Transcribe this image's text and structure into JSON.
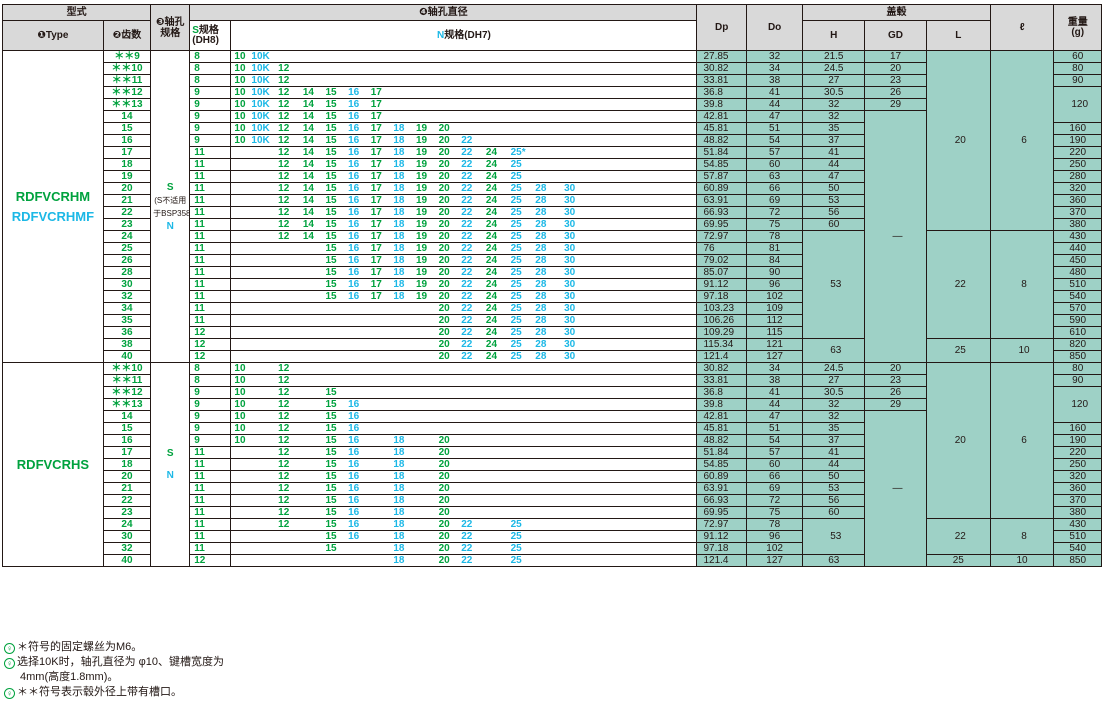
{
  "header": {
    "model": "型式",
    "type_num": "❶",
    "type": "Type",
    "teeth_num": "❷",
    "teeth": "齿数",
    "hole_num": "❸",
    "hole": "轴孔",
    "hole2": "规格",
    "dia_num": "❹",
    "dia": "轴孔直径",
    "s_spec_a": "S",
    "s_spec_b": "规格",
    "s_spec_c": "(DH8)",
    "n_spec_a": "N",
    "n_spec_b": "规格",
    "n_spec_c": "(DH7)",
    "dp": "Dp",
    "do": "Do",
    "hub": "盖毂",
    "h": "H",
    "gd": "GD",
    "l": "L",
    "ell": "ℓ",
    "weight": "重量",
    "weight_unit": "(g)"
  },
  "group1": {
    "type1": "RDFVCRHM",
    "type2": "RDFVCRHMF",
    "s": "S",
    "note": "(S不适用",
    "note2": "于BSP358)",
    "n": "N",
    "gd_dash": "—",
    "rows": [
      {
        "t": "**9",
        "s": "8",
        "n": [
          "10",
          "10K",
          "",
          "",
          "",
          "",
          "",
          "",
          "",
          "",
          "",
          "",
          "",
          "",
          "",
          ""
        ],
        "dp": "27.85",
        "do": "32",
        "h": "21.5",
        "gd": "17",
        "w": "60"
      },
      {
        "t": "**10",
        "s": "8",
        "n": [
          "10",
          "10K",
          "12",
          "",
          "",
          "",
          "",
          "",
          "",
          "",
          "",
          "",
          "",
          "",
          "",
          ""
        ],
        "dp": "30.82",
        "do": "34",
        "h": "24.5",
        "gd": "20",
        "w": "80"
      },
      {
        "t": "**11",
        "s": "8",
        "n": [
          "10",
          "10K",
          "12",
          "",
          "",
          "",
          "",
          "",
          "",
          "",
          "",
          "",
          "",
          "",
          "",
          ""
        ],
        "dp": "33.81",
        "do": "38",
        "h": "27",
        "gd": "23",
        "w": "90"
      },
      {
        "t": "**12",
        "s": "9",
        "n": [
          "10",
          "10K",
          "12",
          "14",
          "15",
          "16",
          "17",
          "",
          "",
          "",
          "",
          "",
          "",
          "",
          "",
          ""
        ],
        "dp": "36.8",
        "do": "41",
        "h": "30.5",
        "gd": "26",
        "w": ""
      },
      {
        "t": "**13",
        "s": "9",
        "n": [
          "10",
          "10K",
          "12",
          "14",
          "15",
          "16",
          "17",
          "",
          "",
          "",
          "",
          "",
          "",
          "",
          "",
          ""
        ],
        "dp": "39.8",
        "do": "44",
        "h": "32",
        "gd": "29",
        "w": ""
      },
      {
        "t": "14",
        "s": "9",
        "n": [
          "10",
          "10K",
          "12",
          "14",
          "15",
          "16",
          "17",
          "",
          "",
          "",
          "",
          "",
          "",
          "",
          "",
          ""
        ],
        "dp": "42.81",
        "do": "47",
        "h": "32",
        "gd": "",
        "w": ""
      },
      {
        "t": "15",
        "s": "9",
        "n": [
          "10",
          "10K",
          "12",
          "14",
          "15",
          "16",
          "17",
          "18",
          "19",
          "20",
          "",
          "",
          "",
          "",
          "",
          ""
        ],
        "dp": "45.81",
        "do": "51",
        "h": "35",
        "gd": "",
        "w": "160"
      },
      {
        "t": "16",
        "s": "9",
        "n": [
          "10",
          "10K",
          "12",
          "14",
          "15",
          "16",
          "17",
          "18",
          "19",
          "20",
          "22",
          "",
          "",
          "",
          "",
          ""
        ],
        "dp": "48.82",
        "do": "54",
        "h": "37",
        "gd": "",
        "w": "190"
      },
      {
        "t": "17",
        "s": "11",
        "n": [
          "",
          "",
          "12",
          "14",
          "15",
          "16",
          "17",
          "18",
          "19",
          "20",
          "22",
          "24",
          "25*",
          "",
          "",
          ""
        ],
        "dp": "51.84",
        "do": "57",
        "h": "41",
        "gd": "",
        "w": "220"
      },
      {
        "t": "18",
        "s": "11",
        "n": [
          "",
          "",
          "12",
          "14",
          "15",
          "16",
          "17",
          "18",
          "19",
          "20",
          "22",
          "24",
          "25",
          "",
          "",
          ""
        ],
        "dp": "54.85",
        "do": "60",
        "h": "44",
        "gd": "",
        "w": "250"
      },
      {
        "t": "19",
        "s": "11",
        "n": [
          "",
          "",
          "12",
          "14",
          "15",
          "16",
          "17",
          "18",
          "19",
          "20",
          "22",
          "24",
          "25",
          "",
          "",
          ""
        ],
        "dp": "57.87",
        "do": "63",
        "h": "47",
        "gd": "",
        "w": "280"
      },
      {
        "t": "20",
        "s": "11",
        "n": [
          "",
          "",
          "12",
          "14",
          "15",
          "16",
          "17",
          "18",
          "19",
          "20",
          "22",
          "24",
          "25",
          "28",
          "30",
          ""
        ],
        "dp": "60.89",
        "do": "66",
        "h": "50",
        "gd": "",
        "w": "320"
      },
      {
        "t": "21",
        "s": "11",
        "n": [
          "",
          "",
          "12",
          "14",
          "15",
          "16",
          "17",
          "18",
          "19",
          "20",
          "22",
          "24",
          "25",
          "28",
          "30",
          ""
        ],
        "dp": "63.91",
        "do": "69",
        "h": "53",
        "gd": "",
        "w": "360"
      },
      {
        "t": "22",
        "s": "11",
        "n": [
          "",
          "",
          "12",
          "14",
          "15",
          "16",
          "17",
          "18",
          "19",
          "20",
          "22",
          "24",
          "25",
          "28",
          "30",
          ""
        ],
        "dp": "66.93",
        "do": "72",
        "h": "56",
        "gd": "",
        "w": "370"
      },
      {
        "t": "23",
        "s": "11",
        "n": [
          "",
          "",
          "12",
          "14",
          "15",
          "16",
          "17",
          "18",
          "19",
          "20",
          "22",
          "24",
          "25",
          "28",
          "30",
          ""
        ],
        "dp": "69.95",
        "do": "75",
        "h": "60",
        "gd": "",
        "w": "380"
      },
      {
        "t": "24",
        "s": "11",
        "n": [
          "",
          "",
          "12",
          "14",
          "15",
          "16",
          "17",
          "18",
          "19",
          "20",
          "22",
          "24",
          "25",
          "28",
          "30",
          ""
        ],
        "dp": "72.97",
        "do": "78",
        "h": "",
        "gd": "",
        "w": "430"
      },
      {
        "t": "25",
        "s": "11",
        "n": [
          "",
          "",
          "",
          "",
          "15",
          "16",
          "17",
          "18",
          "19",
          "20",
          "22",
          "24",
          "25",
          "28",
          "30",
          ""
        ],
        "dp": "76",
        "do": "81",
        "h": "",
        "gd": "",
        "w": "440"
      },
      {
        "t": "26",
        "s": "11",
        "n": [
          "",
          "",
          "",
          "",
          "15",
          "16",
          "17",
          "18",
          "19",
          "20",
          "22",
          "24",
          "25",
          "28",
          "30",
          ""
        ],
        "dp": "79.02",
        "do": "84",
        "h": "",
        "gd": "",
        "w": "450"
      },
      {
        "t": "28",
        "s": "11",
        "n": [
          "",
          "",
          "",
          "",
          "15",
          "16",
          "17",
          "18",
          "19",
          "20",
          "22",
          "24",
          "25",
          "28",
          "30",
          ""
        ],
        "dp": "85.07",
        "do": "90",
        "h": "",
        "gd": "",
        "w": "480"
      },
      {
        "t": "30",
        "s": "11",
        "n": [
          "",
          "",
          "",
          "",
          "15",
          "16",
          "17",
          "18",
          "19",
          "20",
          "22",
          "24",
          "25",
          "28",
          "30",
          ""
        ],
        "dp": "91.12",
        "do": "96",
        "h": "",
        "gd": "",
        "w": "510"
      },
      {
        "t": "32",
        "s": "11",
        "n": [
          "",
          "",
          "",
          "",
          "15",
          "16",
          "17",
          "18",
          "19",
          "20",
          "22",
          "24",
          "25",
          "28",
          "30",
          ""
        ],
        "dp": "97.18",
        "do": "102",
        "h": "",
        "gd": "",
        "w": "540"
      },
      {
        "t": "34",
        "s": "11",
        "n": [
          "",
          "",
          "",
          "",
          "",
          "",
          "",
          "",
          "",
          "20",
          "22",
          "24",
          "25",
          "28",
          "30",
          ""
        ],
        "dp": "103.23",
        "do": "109",
        "h": "",
        "gd": "",
        "w": "570"
      },
      {
        "t": "35",
        "s": "11",
        "n": [
          "",
          "",
          "",
          "",
          "",
          "",
          "",
          "",
          "",
          "20",
          "22",
          "24",
          "25",
          "28",
          "30",
          ""
        ],
        "dp": "106.26",
        "do": "112",
        "h": "",
        "gd": "",
        "w": "590"
      },
      {
        "t": "36",
        "s": "12",
        "n": [
          "",
          "",
          "",
          "",
          "",
          "",
          "",
          "",
          "",
          "20",
          "22",
          "24",
          "25",
          "28",
          "30",
          ""
        ],
        "dp": "109.29",
        "do": "115",
        "h": "",
        "gd": "",
        "w": "610"
      },
      {
        "t": "38",
        "s": "12",
        "n": [
          "",
          "",
          "",
          "",
          "",
          "",
          "",
          "",
          "",
          "20",
          "22",
          "24",
          "25",
          "28",
          "30",
          ""
        ],
        "dp": "115.34",
        "do": "121",
        "h": "",
        "gd": "",
        "w": "820"
      },
      {
        "t": "40",
        "s": "12",
        "n": [
          "",
          "",
          "",
          "",
          "",
          "",
          "",
          "",
          "",
          "20",
          "22",
          "24",
          "25",
          "28",
          "30",
          ""
        ],
        "dp": "121.4",
        "do": "127",
        "h": "",
        "gd": "",
        "w": "850"
      }
    ],
    "merged": {
      "w120": "120",
      "h53": "53",
      "h63": "63",
      "l20": "20",
      "l22": "22",
      "l25": "25",
      "e6": "6",
      "e8": "8",
      "e10": "10"
    }
  },
  "group2": {
    "type": "RDFVCRHS",
    "s": "S",
    "n": "N",
    "gd_dash": "—",
    "rows": [
      {
        "t": "**10",
        "s": "8",
        "n": [
          "10",
          "",
          "12",
          "",
          "",
          "",
          "",
          "",
          "",
          "",
          "",
          "",
          "",
          "",
          "",
          ""
        ],
        "dp": "30.82",
        "do": "34",
        "h": "24.5",
        "gd": "20",
        "w": "80"
      },
      {
        "t": "**11",
        "s": "8",
        "n": [
          "10",
          "",
          "12",
          "",
          "",
          "",
          "",
          "",
          "",
          "",
          "",
          "",
          "",
          "",
          "",
          ""
        ],
        "dp": "33.81",
        "do": "38",
        "h": "27",
        "gd": "23",
        "w": "90"
      },
      {
        "t": "**12",
        "s": "9",
        "n": [
          "10",
          "",
          "12",
          "",
          "15",
          "",
          "",
          "",
          "",
          "",
          "",
          "",
          "",
          "",
          "",
          ""
        ],
        "dp": "36.8",
        "do": "41",
        "h": "30.5",
        "gd": "26",
        "w": ""
      },
      {
        "t": "**13",
        "s": "9",
        "n": [
          "10",
          "",
          "12",
          "",
          "15",
          "16",
          "",
          "",
          "",
          "",
          "",
          "",
          "",
          "",
          "",
          ""
        ],
        "dp": "39.8",
        "do": "44",
        "h": "32",
        "gd": "29",
        "w": ""
      },
      {
        "t": "14",
        "s": "9",
        "n": [
          "10",
          "",
          "12",
          "",
          "15",
          "16",
          "",
          "",
          "",
          "",
          "",
          "",
          "",
          "",
          "",
          ""
        ],
        "dp": "42.81",
        "do": "47",
        "h": "32",
        "gd": "",
        "w": ""
      },
      {
        "t": "15",
        "s": "9",
        "n": [
          "10",
          "",
          "12",
          "",
          "15",
          "16",
          "",
          "",
          "",
          "",
          "",
          "",
          "",
          "",
          "",
          ""
        ],
        "dp": "45.81",
        "do": "51",
        "h": "35",
        "gd": "",
        "w": "160"
      },
      {
        "t": "16",
        "s": "9",
        "n": [
          "10",
          "",
          "12",
          "",
          "15",
          "16",
          "",
          "18",
          "",
          "20",
          "",
          "",
          "",
          "",
          "",
          ""
        ],
        "dp": "48.82",
        "do": "54",
        "h": "37",
        "gd": "",
        "w": "190"
      },
      {
        "t": "17",
        "s": "11",
        "n": [
          "",
          "",
          "12",
          "",
          "15",
          "16",
          "",
          "18",
          "",
          "20",
          "",
          "",
          "",
          "",
          "",
          ""
        ],
        "dp": "51.84",
        "do": "57",
        "h": "41",
        "gd": "",
        "w": "220"
      },
      {
        "t": "18",
        "s": "11",
        "n": [
          "",
          "",
          "12",
          "",
          "15",
          "16",
          "",
          "18",
          "",
          "20",
          "",
          "",
          "",
          "",
          "",
          ""
        ],
        "dp": "54.85",
        "do": "60",
        "h": "44",
        "gd": "",
        "w": "250"
      },
      {
        "t": "20",
        "s": "11",
        "n": [
          "",
          "",
          "12",
          "",
          "15",
          "16",
          "",
          "18",
          "",
          "20",
          "",
          "",
          "",
          "",
          "",
          ""
        ],
        "dp": "60.89",
        "do": "66",
        "h": "50",
        "gd": "",
        "w": "320"
      },
      {
        "t": "21",
        "s": "11",
        "n": [
          "",
          "",
          "12",
          "",
          "15",
          "16",
          "",
          "18",
          "",
          "20",
          "",
          "",
          "",
          "",
          "",
          ""
        ],
        "dp": "63.91",
        "do": "69",
        "h": "53",
        "gd": "",
        "w": "360"
      },
      {
        "t": "22",
        "s": "11",
        "n": [
          "",
          "",
          "12",
          "",
          "15",
          "16",
          "",
          "18",
          "",
          "20",
          "",
          "",
          "",
          "",
          "",
          ""
        ],
        "dp": "66.93",
        "do": "72",
        "h": "56",
        "gd": "",
        "w": "370"
      },
      {
        "t": "23",
        "s": "11",
        "n": [
          "",
          "",
          "12",
          "",
          "15",
          "16",
          "",
          "18",
          "",
          "20",
          "",
          "",
          "",
          "",
          "",
          ""
        ],
        "dp": "69.95",
        "do": "75",
        "h": "60",
        "gd": "",
        "w": "380"
      },
      {
        "t": "24",
        "s": "11",
        "n": [
          "",
          "",
          "12",
          "",
          "15",
          "16",
          "",
          "18",
          "",
          "20",
          "22",
          "",
          "25",
          "",
          "",
          ""
        ],
        "dp": "72.97",
        "do": "78",
        "h": "",
        "gd": "",
        "w": "430"
      },
      {
        "t": "30",
        "s": "11",
        "n": [
          "",
          "",
          "",
          "",
          "15",
          "16",
          "",
          "18",
          "",
          "20",
          "22",
          "",
          "25",
          "",
          "",
          ""
        ],
        "dp": "91.12",
        "do": "96",
        "h": "",
        "gd": "",
        "w": "510"
      },
      {
        "t": "32",
        "s": "11",
        "n": [
          "",
          "",
          "",
          "",
          "15",
          "",
          "",
          "18",
          "",
          "20",
          "22",
          "",
          "25",
          "",
          "",
          ""
        ],
        "dp": "97.18",
        "do": "102",
        "h": "",
        "gd": "",
        "w": "540"
      },
      {
        "t": "40",
        "s": "12",
        "n": [
          "",
          "",
          "",
          "",
          "",
          "",
          "",
          "18",
          "",
          "20",
          "22",
          "",
          "25",
          "",
          "",
          ""
        ],
        "dp": "121.4",
        "do": "127",
        "h": "63",
        "gd": "",
        "w": "850"
      }
    ],
    "merged": {
      "w120": "120",
      "h53": "53",
      "l20": "20",
      "l22": "22",
      "l25": "25",
      "e6": "6",
      "e8": "8",
      "e10": "10"
    }
  },
  "notes": [
    {
      "icon": "♀",
      "text": "＊符号的固定螺丝为M6。"
    },
    {
      "icon": "♀",
      "text": "选择10K时，轴孔直径为 φ10、键槽宽度为"
    },
    {
      "icon": "",
      "text": "4mm(高度1.8mm)。"
    },
    {
      "icon": "♀",
      "text": "＊＊符号表示毂外径上带有槽口。"
    }
  ],
  "colors": {
    "green": "#00a23e",
    "cyan": "#1cb8e6",
    "teal": "#9ed1c6",
    "gray": "#d9d9d9"
  }
}
